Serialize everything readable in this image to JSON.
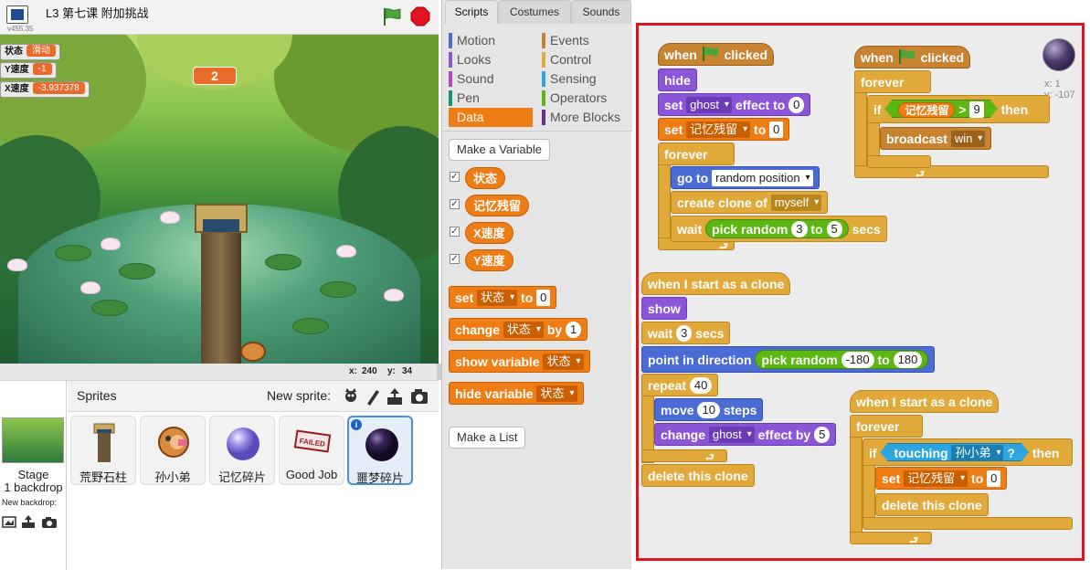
{
  "stage_header": {
    "title": "L3 第七课 附加挑战",
    "version": "v455.35"
  },
  "monitors": [
    {
      "label": "状态",
      "value": "滑动"
    },
    {
      "label": "Y速度",
      "value": "-1"
    },
    {
      "label": "X速度",
      "value": "-3.937378"
    }
  ],
  "stage": {
    "score_value": "2",
    "x_label": "x:",
    "x_value": "240",
    "y_label": "y:",
    "y_value": "34"
  },
  "sprites_panel": {
    "title": "Sprites",
    "new_sprite_label": "New sprite:",
    "stage_label": "Stage",
    "backdrop_count": "1 backdrop",
    "new_backdrop_label": "New backdrop:",
    "sprites": [
      {
        "name": "荒野石柱"
      },
      {
        "name": "孙小弟"
      },
      {
        "name": "记忆碎片"
      },
      {
        "name": "Good Job"
      },
      {
        "name": "噩梦碎片",
        "selected": true
      }
    ]
  },
  "tabs": [
    "Scripts",
    "Costumes",
    "Sounds"
  ],
  "categories": [
    {
      "label": "Motion",
      "color": "#4a6cd4"
    },
    {
      "label": "Events",
      "color": "#c88330"
    },
    {
      "label": "Looks",
      "color": "#8a55d7"
    },
    {
      "label": "Control",
      "color": "#e1a83a"
    },
    {
      "label": "Sound",
      "color": "#bb42c3"
    },
    {
      "label": "Sensing",
      "color": "#2ca5e2"
    },
    {
      "label": "Pen",
      "color": "#0e9a6c"
    },
    {
      "label": "Operators",
      "color": "#5cb712"
    },
    {
      "label": "Data",
      "color": "#ee7d16"
    },
    {
      "label": "More Blocks",
      "color": "#632d99"
    }
  ],
  "palette": {
    "make_variable": "Make a Variable",
    "variables": [
      "状态",
      "记忆残留",
      "X速度",
      "Y速度"
    ],
    "blocks": {
      "set": {
        "kw": "set",
        "var": "状态",
        "to": "to",
        "val": "0"
      },
      "change": {
        "kw": "change",
        "var": "状态",
        "by": "by",
        "val": "1"
      },
      "show": {
        "kw": "show variable",
        "var": "状态"
      },
      "hide": {
        "kw": "hide variable",
        "var": "状态"
      }
    },
    "make_list": "Make a List"
  },
  "sprite_info": {
    "x_label": "x: 1",
    "y_label": "y: -107"
  },
  "scripts": {
    "s1": {
      "when": "when",
      "clicked": "clicked",
      "hide": "hide",
      "set": "set",
      "effect": "ghost",
      "effect_to": "effect to",
      "effect_val": "0",
      "set2": "set",
      "var": "记忆残留",
      "to": "to",
      "var_val": "0",
      "forever": "forever",
      "goto": "go to",
      "goto_target": "random position",
      "create": "create clone of",
      "create_target": "myself",
      "wait": "wait",
      "pick": "pick random",
      "pick_a": "3",
      "pick_to": "to",
      "pick_b": "5",
      "secs": "secs"
    },
    "s2": {
      "when": "when",
      "clicked": "clicked",
      "forever": "forever",
      "if": "if",
      "var": "记忆残留",
      "gt": ">",
      "num": "9",
      "then": "then",
      "broadcast": "broadcast",
      "msg": "win"
    },
    "s3": {
      "hat": "when I start as a clone",
      "show": "show",
      "wait": "wait",
      "wait_val": "3",
      "secs": "secs",
      "point": "point in direction",
      "pick": "pick random",
      "pick_a": "-180",
      "pick_to": "to",
      "pick_b": "180",
      "repeat": "repeat",
      "repeat_val": "40",
      "move": "move",
      "move_val": "10",
      "steps": "steps",
      "change": "change",
      "effect": "ghost",
      "effect_by": "effect by",
      "effect_val": "5",
      "delete": "delete this clone"
    },
    "s4": {
      "hat": "when I start as a clone",
      "forever": "forever",
      "if": "if",
      "touching": "touching",
      "target": "孙小弟",
      "q": "?",
      "then": "then",
      "set": "set",
      "var": "记忆残留",
      "to": "to",
      "val": "0",
      "delete": "delete this clone"
    }
  }
}
